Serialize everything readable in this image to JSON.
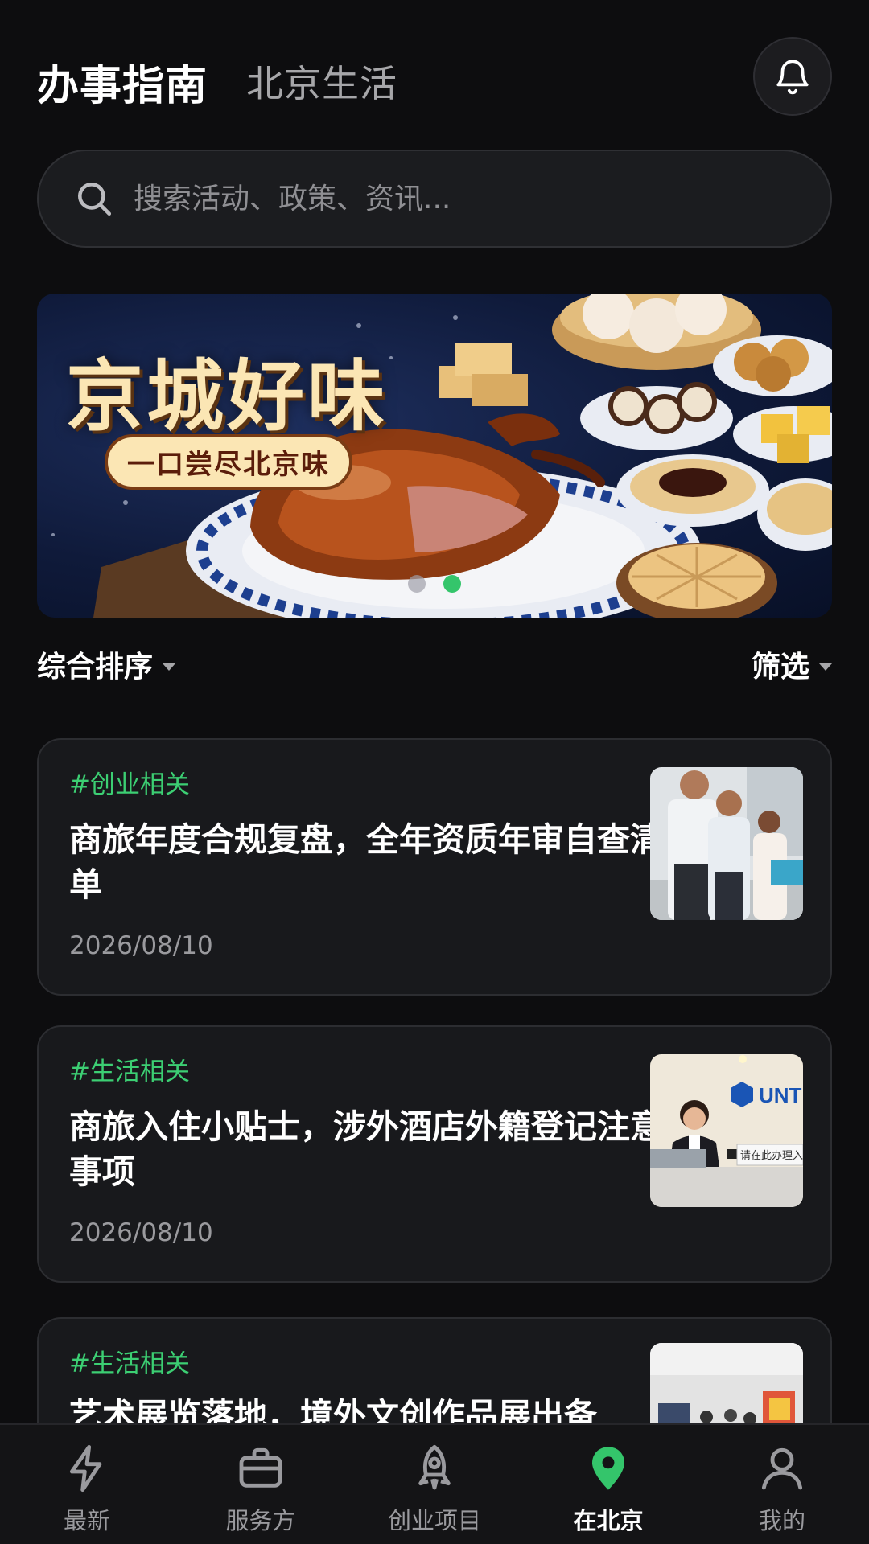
{
  "header": {
    "active_tab": "办事指南",
    "inactive_tab": "北京生活",
    "bell_icon": "bell-icon"
  },
  "search": {
    "placeholder": "搜索活动、政策、资讯...",
    "icon": "search-icon"
  },
  "banner": {
    "title": "京城好味",
    "subtitle": "一口尝尽北京味",
    "slide_count": 2,
    "active_slide": 2
  },
  "sort_bar": {
    "sort_label": "综合排序",
    "filter_label": "筛选"
  },
  "articles": [
    {
      "tag": "#创业相关",
      "title": "商旅年度合规复盘，全年资质年审自查清单",
      "date": "2026/08/10"
    },
    {
      "tag": "#生活相关",
      "title": "商旅入住小贴士，涉外酒店外籍登记注意事项",
      "date": "2026/08/10"
    },
    {
      "tag": "#生活相关",
      "title": "艺术展览落地，境外文创作品展出备"
    }
  ],
  "thumb_text": {
    "hotel_logo": "UNT",
    "hotel_sign": "请在此办理入住"
  },
  "bottom_nav": [
    {
      "label": "最新",
      "icon": "lightning-icon"
    },
    {
      "label": "服务方",
      "icon": "briefcase-icon"
    },
    {
      "label": "创业项目",
      "icon": "rocket-icon"
    },
    {
      "label": "在北京",
      "icon": "location-pin-icon",
      "active": true
    },
    {
      "label": "我的",
      "icon": "user-icon"
    }
  ],
  "colors": {
    "background": "#0d0d0f",
    "card": "#18191c",
    "accent_green": "#3ccf73",
    "muted_text": "#9a9a9e"
  }
}
